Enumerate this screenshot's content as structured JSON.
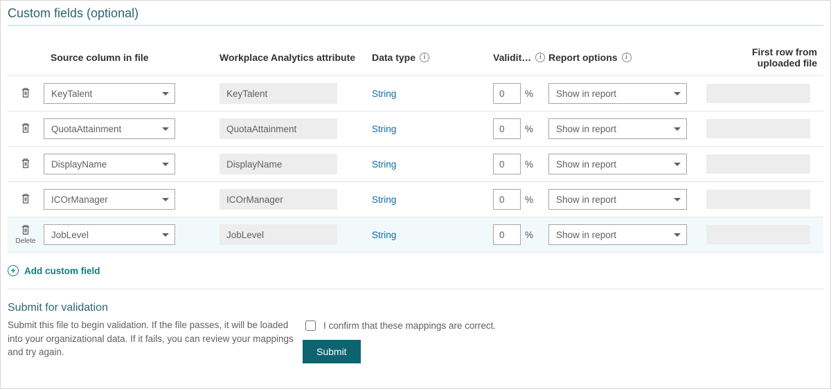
{
  "section_title": "Custom fields (optional)",
  "headers": {
    "source": "Source column in file",
    "attribute": "Workplace Analytics attribute",
    "datatype": "Data type",
    "validity": "Validit…",
    "report": "Report options",
    "firstrow": "First row from uploaded file"
  },
  "percent_symbol": "%",
  "rows": [
    {
      "source": "KeyTalent",
      "attribute": "KeyTalent",
      "datatype": "String",
      "validity": "0",
      "report": "Show in report",
      "delete_label": ""
    },
    {
      "source": "QuotaAttainment",
      "attribute": "QuotaAttainment",
      "datatype": "String",
      "validity": "0",
      "report": "Show in report",
      "delete_label": ""
    },
    {
      "source": "DisplayName",
      "attribute": "DisplayName",
      "datatype": "String",
      "validity": "0",
      "report": "Show in report",
      "delete_label": ""
    },
    {
      "source": "ICOrManager",
      "attribute": "ICOrManager",
      "datatype": "String",
      "validity": "0",
      "report": "Show in report",
      "delete_label": ""
    },
    {
      "source": "JobLevel",
      "attribute": "JobLevel",
      "datatype": "String",
      "validity": "0",
      "report": "Show in report",
      "delete_label": "Delete"
    }
  ],
  "add_field_label": "Add custom field",
  "submit": {
    "title": "Submit for validation",
    "desc": "Submit this file to begin validation. If the file passes, it will be loaded into your organizational data. If it fails, you can review your mappings and try again.",
    "confirm_label": "I confirm that these mappings are correct.",
    "button": "Submit"
  }
}
